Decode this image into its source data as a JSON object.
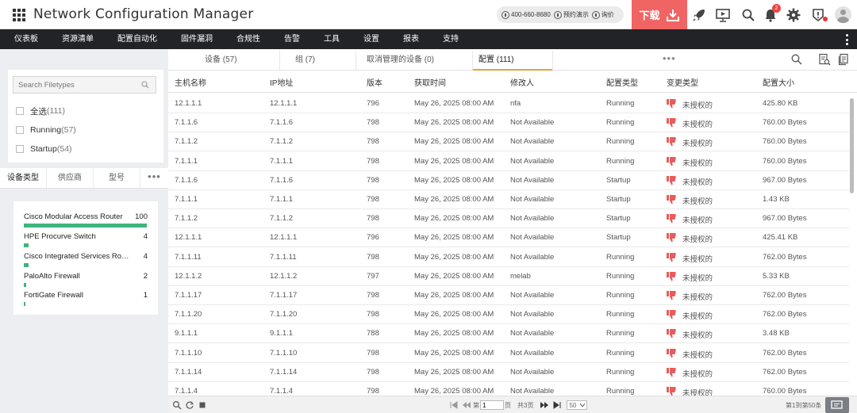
{
  "header": {
    "app_title": "Network Configuration Manager",
    "phone": "400-660-8680",
    "demo_label": "预约演示",
    "quote_label": "询价",
    "download_label": "下载",
    "notification_count": "2"
  },
  "nav": {
    "items": [
      "仪表板",
      "资源清单",
      "配置自动化",
      "固件漏洞",
      "合规性",
      "告警",
      "工具",
      "设置",
      "报表",
      "支持"
    ]
  },
  "filetypes": {
    "search_placeholder": "Search Filetypes",
    "items": [
      {
        "label": "全选",
        "count": "(111)"
      },
      {
        "label": "Running",
        "count": "(57)"
      },
      {
        "label": "Startup",
        "count": "(54)"
      }
    ]
  },
  "left_tabs": [
    "设备类型",
    "供应商",
    "型号"
  ],
  "device_types": [
    {
      "name": "Cisco Modular Access Router",
      "count": "100",
      "fraction": 1.0
    },
    {
      "name": "HPE Procurve Switch",
      "count": "4",
      "fraction": 0.04
    },
    {
      "name": "Cisco Integrated Services Router ...",
      "count": "4",
      "fraction": 0.04
    },
    {
      "name": "PaloAlto Firewall",
      "count": "2",
      "fraction": 0.02
    },
    {
      "name": "FortiGate Firewall",
      "count": "1",
      "fraction": 0.01
    }
  ],
  "main_tabs": [
    {
      "label": "设备 (57)",
      "active": false
    },
    {
      "label": "组 (7)",
      "active": false
    },
    {
      "label": "取消管理的设备 (0)",
      "active": false
    },
    {
      "label": "配置 (111)",
      "active": true
    }
  ],
  "table": {
    "columns": [
      "主机名称",
      "IP地址",
      "版本",
      "获取时间",
      "修改人",
      "配置类型",
      "变更类型",
      "配置大小"
    ],
    "rows": [
      [
        "12.1.1.1",
        "12.1.1.1",
        "796",
        "May 26, 2025 08:00 AM",
        "nfa",
        "Running",
        "未授权的",
        "425.80 KB"
      ],
      [
        "7.1.1.6",
        "7.1.1.6",
        "798",
        "May 26, 2025 08:00 AM",
        "Not Available",
        "Running",
        "未授权的",
        "760.00 Bytes"
      ],
      [
        "7.1.1.2",
        "7.1.1.2",
        "798",
        "May 26, 2025 08:00 AM",
        "Not Available",
        "Running",
        "未授权的",
        "760.00 Bytes"
      ],
      [
        "7.1.1.1",
        "7.1.1.1",
        "798",
        "May 26, 2025 08:00 AM",
        "Not Available",
        "Running",
        "未授权的",
        "760.00 Bytes"
      ],
      [
        "7.1.1.6",
        "7.1.1.6",
        "798",
        "May 26, 2025 08:00 AM",
        "Not Available",
        "Startup",
        "未授权的",
        "967.00 Bytes"
      ],
      [
        "7.1.1.1",
        "7.1.1.1",
        "798",
        "May 26, 2025 08:00 AM",
        "Not Available",
        "Startup",
        "未授权的",
        "1.43 KB"
      ],
      [
        "7.1.1.2",
        "7.1.1.2",
        "798",
        "May 26, 2025 08:00 AM",
        "Not Available",
        "Startup",
        "未授权的",
        "967.00 Bytes"
      ],
      [
        "12.1.1.1",
        "12.1.1.1",
        "796",
        "May 26, 2025 08:00 AM",
        "Not Available",
        "Startup",
        "未授权的",
        "425.41 KB"
      ],
      [
        "7.1.1.11",
        "7.1.1.11",
        "798",
        "May 26, 2025 08:00 AM",
        "Not Available",
        "Running",
        "未授权的",
        "762.00 Bytes"
      ],
      [
        "12.1.1.2",
        "12.1.1.2",
        "797",
        "May 26, 2025 08:00 AM",
        "melab",
        "Running",
        "未授权的",
        "5.33 KB"
      ],
      [
        "7.1.1.17",
        "7.1.1.17",
        "798",
        "May 26, 2025 08:00 AM",
        "Not Available",
        "Running",
        "未授权的",
        "762.00 Bytes"
      ],
      [
        "7.1.1.20",
        "7.1.1.20",
        "798",
        "May 26, 2025 08:00 AM",
        "Not Available",
        "Running",
        "未授权的",
        "762.00 Bytes"
      ],
      [
        "9.1.1.1",
        "9.1.1.1",
        "788",
        "May 26, 2025 08:00 AM",
        "Not Available",
        "Running",
        "未授权的",
        "3.48 KB"
      ],
      [
        "7.1.1.10",
        "7.1.1.10",
        "798",
        "May 26, 2025 08:00 AM",
        "Not Available",
        "Running",
        "未授权的",
        "762.00 Bytes"
      ],
      [
        "7.1.1.14",
        "7.1.1.14",
        "798",
        "May 26, 2025 08:00 AM",
        "Not Available",
        "Running",
        "未授权的",
        "762.00 Bytes"
      ],
      [
        "7.1.1.4",
        "7.1.1.4",
        "798",
        "May 26, 2025 08:00 AM",
        "Not Available",
        "Running",
        "未授权的",
        "760.00 Bytes"
      ]
    ]
  },
  "footer": {
    "page_prefix": "第",
    "page_value": "1",
    "page_suffix": "页",
    "total_pages": "共3页",
    "page_size": "50",
    "range_text": "第1到第50条"
  },
  "colors": {
    "accent_download": "#f06464",
    "nav_background": "#222327",
    "bar_green": "#3eb57a",
    "thumb_red": "#e85c5c",
    "tab_underline": "#e8a030"
  },
  "icons": {
    "thumb": "thumbs-down-icon"
  }
}
